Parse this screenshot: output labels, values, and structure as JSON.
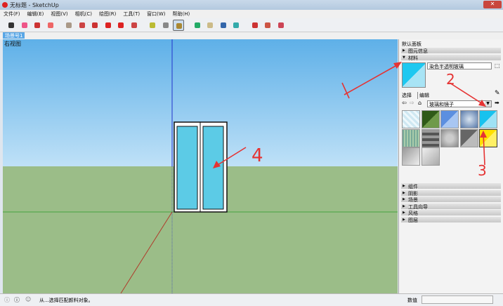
{
  "window": {
    "title": "无标题 - SketchUp"
  },
  "menu": [
    "文件(F)",
    "编辑(E)",
    "视图(V)",
    "相机(C)",
    "绘图(R)",
    "工具(T)",
    "窗口(W)",
    "帮助(H)"
  ],
  "toolbar": [
    "select",
    "eraser",
    "pencil",
    "arc",
    "rectangle",
    "push-pull",
    "follow-me",
    "move",
    "rotate",
    "scale",
    "tape-measure",
    "text",
    "paint-bucket",
    "orbit",
    "pan",
    "zoom",
    "zoom-extents",
    "components",
    "warehouse",
    "share"
  ],
  "scene": {
    "tab": "场景号1",
    "view_label": "右视图"
  },
  "panel": {
    "title": "默认面板",
    "entity_info": "图元信息",
    "materials": "材料",
    "material_name": "染色半透明玻璃",
    "tab_select": "选择",
    "tab_edit": "编辑",
    "category": "玻璃和镜子",
    "collapsed": [
      "组件",
      "阴影",
      "场景",
      "工具向导",
      "风格",
      "图层"
    ]
  },
  "annotations": [
    "1",
    "2",
    "3",
    "4"
  ],
  "status": {
    "message": "从...选择匹配颜料对象。",
    "value_label": "数值",
    "value": ""
  },
  "colors": {
    "accent": "#e53333",
    "glass": "#5ccbe6"
  }
}
